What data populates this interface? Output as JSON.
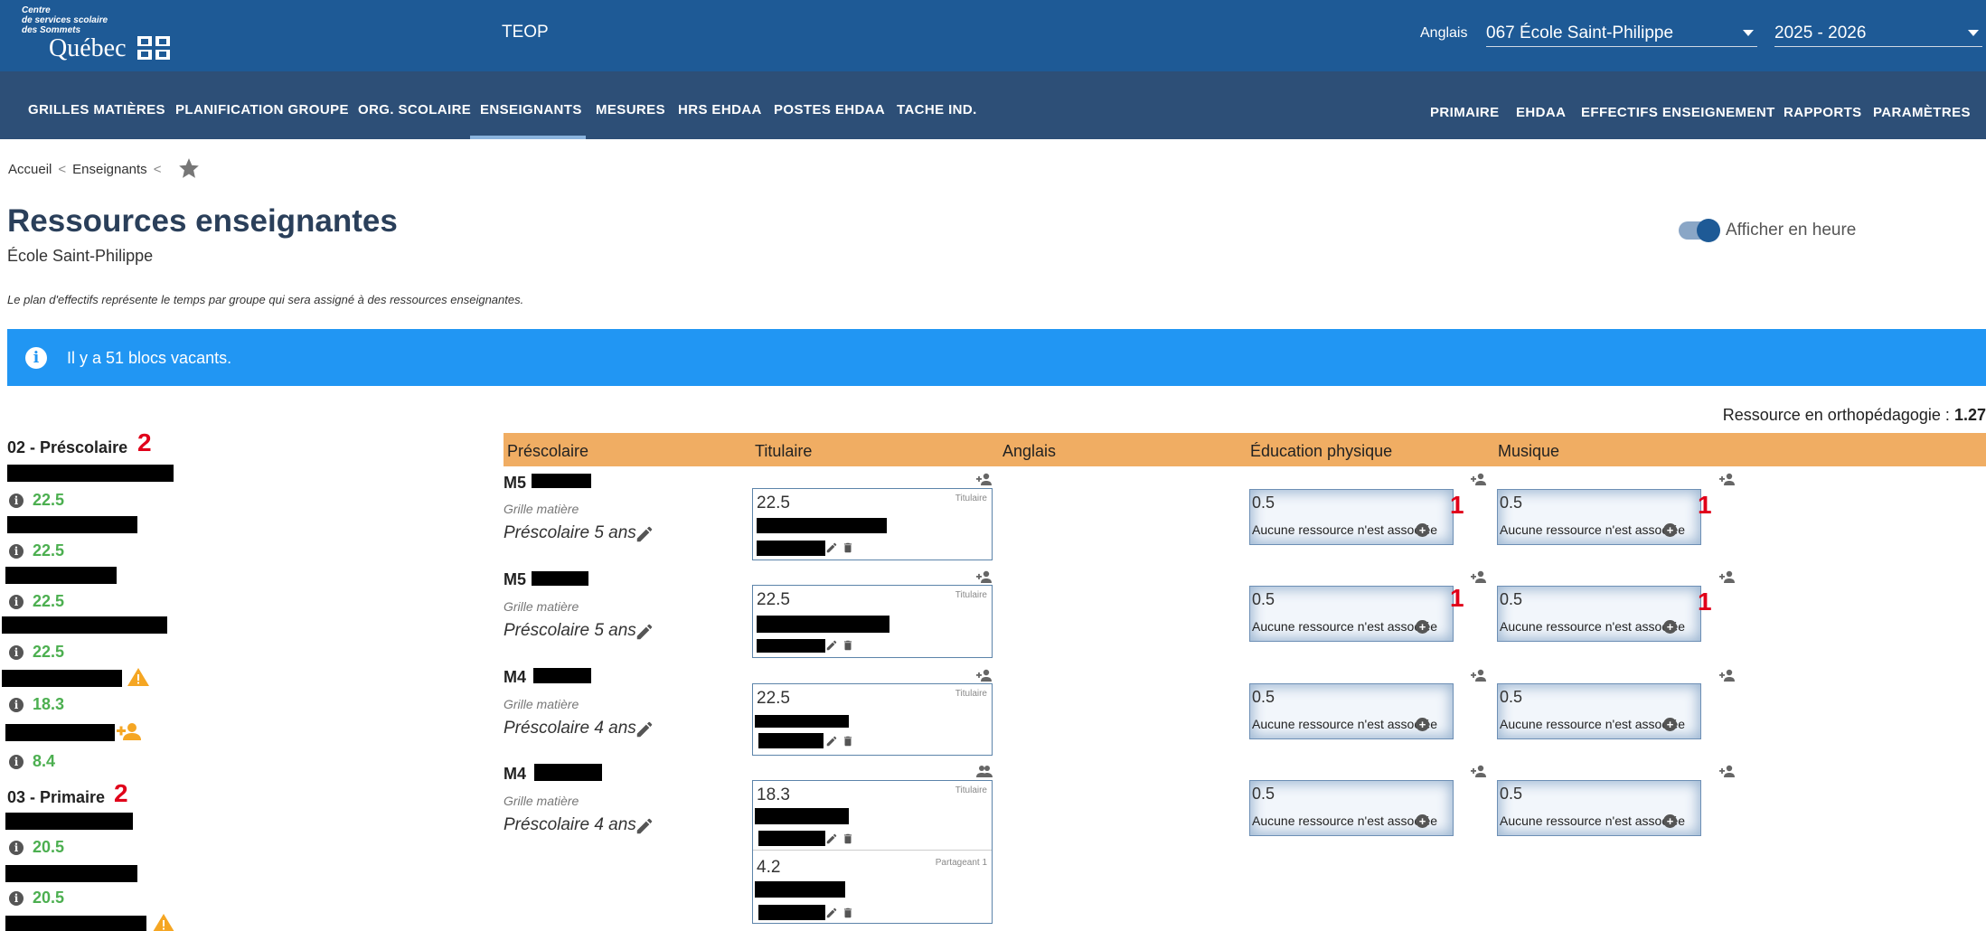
{
  "header": {
    "org_line1": "Centre",
    "org_line2": "de services scolaire",
    "org_line3": "des Sommets",
    "org_name": "Québec",
    "app_title": "TEOP",
    "lang_label": "Anglais",
    "school_select": "067 École Saint-Philippe",
    "year_select": "2025 - 2026"
  },
  "nav": {
    "left": [
      "GRILLES MATIÈRES",
      "PLANIFICATION GROUPE",
      "ORG. SCOLAIRE",
      "ENSEIGNANTS",
      "MESURES",
      "HRS EHDAA",
      "POSTES EHDAA",
      "TACHE IND."
    ],
    "right": [
      "PRIMAIRE",
      "EHDAA",
      "EFFECTIFS ENSEIGNEMENT",
      "RAPPORTS",
      "PARAMÈTRES"
    ],
    "active": "ENSEIGNANTS"
  },
  "breadcrumb": [
    "Accueil",
    "Enseignants"
  ],
  "page": {
    "title": "Ressources enseignantes",
    "subtitle": "École Saint-Philippe",
    "description": "Le plan d'effectifs représente le temps par groupe qui sera assigné à des ressources enseignantes.",
    "toggle_label": "Afficher en heure",
    "toggle_on": true,
    "alert": "Il y a 51 blocs vacants.",
    "ortho_label": "Ressource en orthopédagogie :",
    "ortho_value": "1.27"
  },
  "left_list": {
    "sections": [
      {
        "title": "02 - Préscolaire",
        "badge": "2",
        "entries": [
          "22.5",
          "22.5",
          "22.5",
          "22.5",
          "18.3",
          "8.4"
        ]
      },
      {
        "title": "03 - Primaire",
        "badge": "2",
        "entries": [
          "20.5",
          "20.5"
        ]
      }
    ]
  },
  "table": {
    "headers": [
      "Préscolaire",
      "Titulaire",
      "Anglais",
      "Éducation physique",
      "Musique"
    ],
    "grid_label": "Grille matière",
    "empty_msg": "Aucune ressource n'est associée",
    "rows": [
      {
        "code": "M5",
        "grid": "Préscolaire 5 ans",
        "tit_value": "22.5",
        "tit_role": "Titulaire",
        "edu": "0.5",
        "edu_badge": "1",
        "mus": "0.5",
        "mus_badge": "1"
      },
      {
        "code": "M5",
        "grid": "Préscolaire 5 ans",
        "tit_value": "22.5",
        "tit_role": "Titulaire",
        "edu": "0.5",
        "edu_badge": "1",
        "mus": "0.5",
        "mus_badge": "1"
      },
      {
        "code": "M4",
        "grid": "Préscolaire 4 ans",
        "tit_value": "22.5",
        "tit_role": "Titulaire",
        "edu": "0.5",
        "edu_badge": "",
        "mus": "0.5",
        "mus_badge": ""
      },
      {
        "code": "M4",
        "grid": "Préscolaire 4 ans",
        "tit_value": "18.3",
        "tit_role": "Titulaire",
        "share_value": "4.2",
        "share_role": "Partageant 1",
        "edu": "0.5",
        "edu_badge": "",
        "mus": "0.5",
        "mus_badge": ""
      }
    ]
  },
  "colors": {
    "topbar": "#1e5a96",
    "navbar": "#2d4f77",
    "alert": "#2196f3",
    "table_header": "#f0ad63",
    "value_green": "#4caf50",
    "badge_red": "#e0001a"
  },
  "icons": [
    "info-icon",
    "warning-icon",
    "person-add-icon",
    "pencil-icon",
    "trash-icon",
    "star-icon",
    "plus-circle-icon",
    "group-icon"
  ]
}
